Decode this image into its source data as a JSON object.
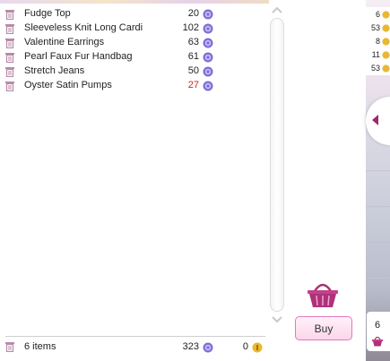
{
  "cart": {
    "items": [
      {
        "name": "Fudge Top",
        "price": "20",
        "low": false
      },
      {
        "name": "Sleeveless Knit Long Cardi",
        "price": "102",
        "low": false
      },
      {
        "name": "Valentine Earrings",
        "price": "63",
        "low": false
      },
      {
        "name": "Pearl Faux Fur Handbag",
        "price": "61",
        "low": false
      },
      {
        "name": "Stretch Jeans",
        "price": "50",
        "low": false
      },
      {
        "name": "Oyster Satin Pumps",
        "price": "27",
        "low": true
      }
    ],
    "footer": {
      "count": "6 items",
      "total_gems": "323",
      "total_gold": "0"
    },
    "buy_label": "Buy"
  },
  "side": {
    "mini_prices": [
      "6",
      "53",
      "8",
      "11",
      "53"
    ],
    "cart_count": "6"
  },
  "colors": {
    "accent_pink": "#b0307a",
    "low_price_red": "#d42020",
    "gem_purple": "#7b6fd6",
    "gold_coin": "#e8b830"
  },
  "icons": {
    "delete": "trash-icon",
    "gem": "gem-coin-icon",
    "gold": "gold-coin-icon",
    "basket": "shopping-basket-icon",
    "collapse": "chevron-left-icon",
    "scroll_up": "chevron-up-icon",
    "scroll_down": "chevron-down-icon"
  }
}
